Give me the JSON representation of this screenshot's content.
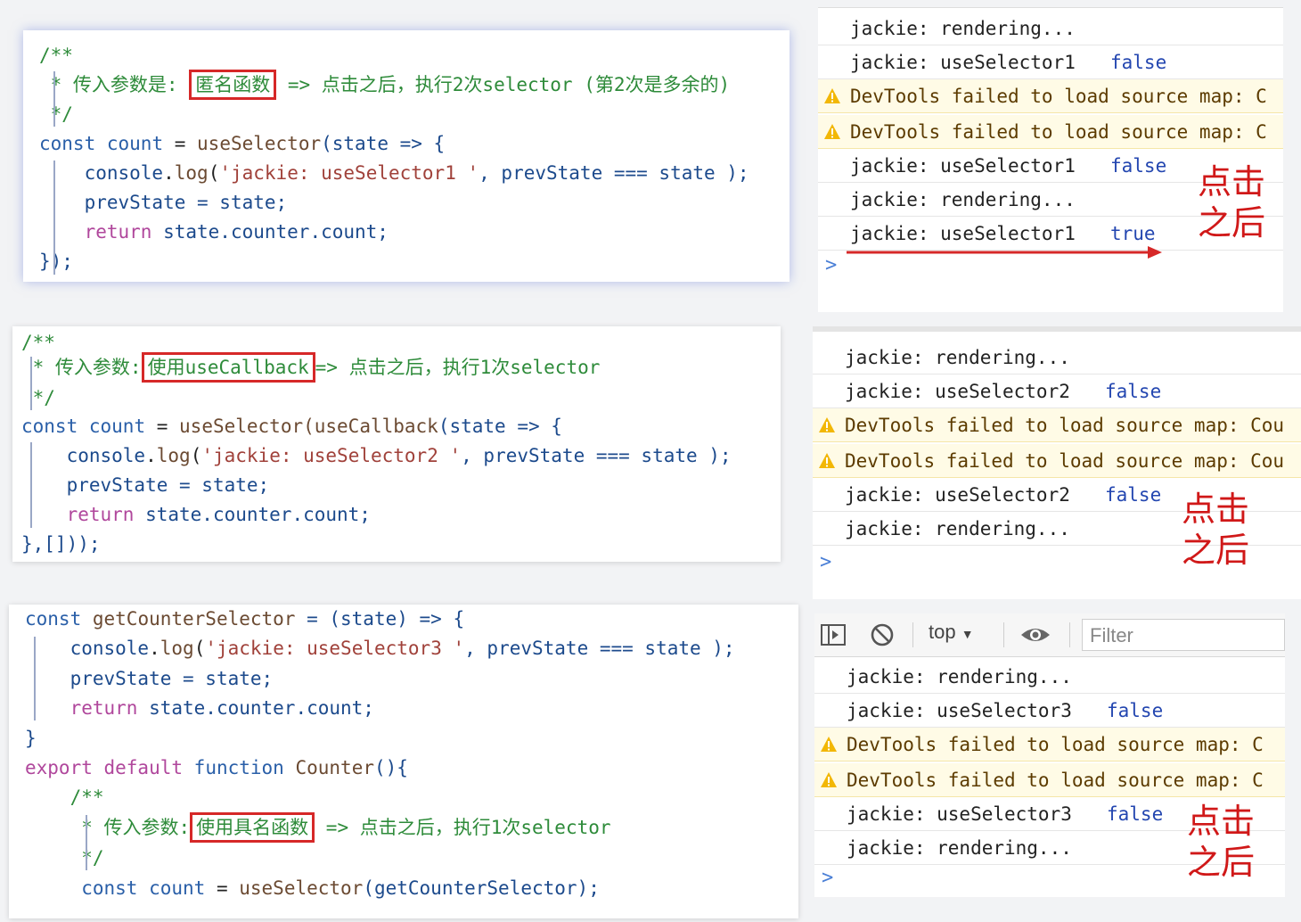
{
  "panel1": {
    "lines": [
      {
        "t1": "/**"
      },
      {
        "pre": " * 传入参数是: ",
        "boxed": "匿名函数",
        "post": " => 点击之后，执行2次selector (第2次是多余的)"
      },
      {
        "t1": " */"
      },
      {
        "kw": "const",
        "sp1": " ",
        "id": "count",
        "eq": " = ",
        "fn": "useSelector",
        "rest": "(state => {"
      },
      {
        "indent": "    ",
        "a": "console",
        "b": ".",
        "c": "log",
        "d": "(",
        "s": "'jackie: useSelector1 '",
        "e": ", prevState === state );"
      },
      {
        "indent": "    ",
        "a": "prevState = state;"
      },
      {
        "indent": "    ",
        "ret": "return",
        "rest": " state.counter.count;"
      },
      {
        "t1": "});"
      }
    ]
  },
  "panel2": {
    "lines": [
      {
        "t1": "/**"
      },
      {
        "pre": " * 传入参数:",
        "boxed": "使用useCallback",
        "post": "=> 点击之后，执行1次selector"
      },
      {
        "t1": " */"
      },
      {
        "kw": "const",
        "sp1": " ",
        "id": "count",
        "eq": " = ",
        "fn": "useSelector(useCallback",
        "rest": "(state => {"
      },
      {
        "indent": "    ",
        "a": "console",
        "b": ".",
        "c": "log",
        "d": "(",
        "s": "'jackie: useSelector2 '",
        "e": ", prevState === state );"
      },
      {
        "indent": "    ",
        "a": "prevState = state;"
      },
      {
        "indent": "    ",
        "ret": "return",
        "rest": " state.counter.count;"
      },
      {
        "t1": "},[]));"
      }
    ]
  },
  "panel3": {
    "lines": [
      {
        "kw": "const",
        "sp1": " ",
        "fn": "getCounterSelector",
        "rest": " = (state) => {"
      },
      {
        "indent": "    ",
        "a": "console",
        "b": ".",
        "c": "log",
        "d": "(",
        "s": "'jackie: useSelector3 '",
        "e": ", prevState === state );"
      },
      {
        "indent": "    ",
        "a": "prevState = state;"
      },
      {
        "indent": "    ",
        "ret": "return",
        "rest": " state.counter.count;"
      },
      {
        "t1": "}"
      },
      {
        "kw2": "export default",
        "kw": "function",
        "fn": "Counter",
        "rest": "(){"
      },
      {
        "cmt": "    /**"
      },
      {
        "pre": "     * 传入参数:",
        "boxed": "使用具名函数",
        "post": " => 点击之后，执行1次selector"
      },
      {
        "cmt": "     */"
      },
      {
        "kw": "const",
        "sp1": " ",
        "id": "count",
        "eq": " = ",
        "fn": "useSelector",
        "rest": "(getCounterSelector);",
        "indent": "     "
      }
    ]
  },
  "console1": {
    "rows": [
      {
        "type": "log",
        "text": "jackie: rendering...",
        "bool": ""
      },
      {
        "type": "log",
        "text": "jackie: useSelector1",
        "bool": "false"
      },
      {
        "type": "warn",
        "text": "DevTools failed to load source map: C",
        "bool": ""
      },
      {
        "type": "warn",
        "text": "DevTools failed to load source map: C",
        "bool": ""
      },
      {
        "type": "log",
        "text": "jackie: useSelector1",
        "bool": "false"
      },
      {
        "type": "log",
        "text": "jackie: rendering...",
        "bool": ""
      },
      {
        "type": "log",
        "text": "jackie: useSelector1",
        "bool": "true"
      }
    ],
    "prompt": ">",
    "annotation": [
      "点击",
      "之后"
    ]
  },
  "console2": {
    "rows": [
      {
        "type": "log",
        "text": "jackie: rendering...",
        "bool": ""
      },
      {
        "type": "log",
        "text": "jackie: useSelector2",
        "bool": "false"
      },
      {
        "type": "warn",
        "text": "DevTools failed to load source map: Cou",
        "bool": ""
      },
      {
        "type": "warn",
        "text": "DevTools failed to load source map: Cou",
        "bool": ""
      },
      {
        "type": "log",
        "text": "jackie: useSelector2",
        "bool": "false"
      },
      {
        "type": "log",
        "text": "jackie: rendering...",
        "bool": ""
      }
    ],
    "prompt": ">",
    "annotation": [
      "点击",
      "之后"
    ]
  },
  "console3": {
    "toolbar": {
      "context": "top",
      "filter_placeholder": "Filter"
    },
    "rows": [
      {
        "type": "log",
        "text": "jackie: rendering...",
        "bool": ""
      },
      {
        "type": "log",
        "text": "jackie: useSelector3",
        "bool": "false"
      },
      {
        "type": "warn",
        "text": "DevTools failed to load source map: C",
        "bool": ""
      },
      {
        "type": "warn",
        "text": "DevTools failed to load source map: C",
        "bool": ""
      },
      {
        "type": "log",
        "text": "jackie: useSelector3",
        "bool": "false"
      },
      {
        "type": "log",
        "text": "jackie: rendering...",
        "bool": ""
      }
    ],
    "prompt": ">",
    "annotation": [
      "点击",
      "之后"
    ]
  },
  "colors": {
    "accent_red": "#d62828",
    "bool_blue": "#2346b0",
    "comment_green": "#2e8b3a"
  }
}
